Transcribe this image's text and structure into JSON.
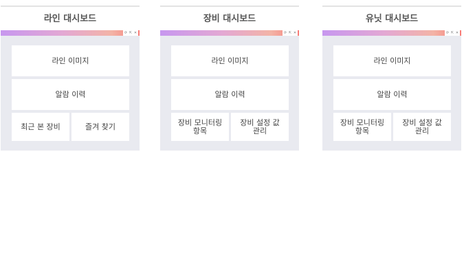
{
  "panels": [
    {
      "title": "라인 대시보드",
      "cards": [
        "라인 이미지",
        "알람 이력",
        "최근 본 장비",
        "즐겨 찾기"
      ]
    },
    {
      "title": "장비 대시보드",
      "cards": [
        "라인 이미지",
        "알람 이력",
        "장비 모니터링\n항목",
        "장비 설정 값\n관리"
      ]
    },
    {
      "title": "유닛 대시보드",
      "cards": [
        "라인 이미지",
        "알람 이력",
        "장비 모니터링\n항목",
        "장비 설정 값\n관리"
      ]
    }
  ],
  "bar_tools": [
    "⟳",
    "⇱",
    "✕"
  ],
  "colors": {
    "panel_background": "#e9eaf0",
    "card_background": "#ffffff",
    "bar_gradient_start": "#c797ef",
    "bar_gradient_end": "#f87a75"
  }
}
